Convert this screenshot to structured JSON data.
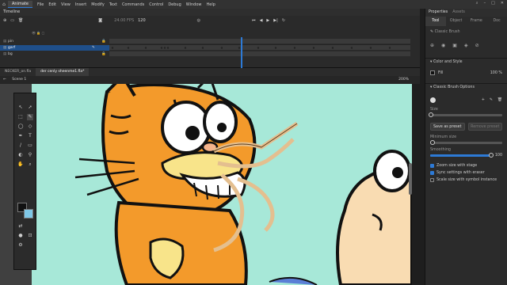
{
  "menubar": {
    "workspace": "Animate",
    "items": [
      "File",
      "Edit",
      "View",
      "Insert",
      "Modify",
      "Text",
      "Commands",
      "Control",
      "Debug",
      "Window",
      "Help"
    ]
  },
  "timeline": {
    "title": "Timeline",
    "fps": "24.00 FPS",
    "frame": "120",
    "layers": [
      {
        "name": "pin"
      },
      {
        "name": "garf"
      },
      {
        "name": "bg"
      }
    ],
    "ruler": [
      "5",
      "10",
      "15",
      "20",
      "25",
      "30",
      "35",
      "40",
      "45",
      "50",
      "55",
      "60",
      "65",
      "70",
      "75"
    ]
  },
  "docbar": {
    "tabs": [
      "NECKER_on.fla",
      "der cenly sheenme1.fla*"
    ]
  },
  "scenebar": {
    "scene": "Scene 1",
    "zoom": "200%"
  },
  "props": {
    "title": "Properties",
    "library_tab": "Assets",
    "tabs": [
      "Tool",
      "Object",
      "Frame",
      "Doc"
    ],
    "tool_name": "Classic Brush",
    "color_style": "Color and Style",
    "fill_label": "Fill",
    "fill_percent": "100 %",
    "brush_options": "Classic Brush Options",
    "size_label": "Size",
    "save_preset": "Save as preset",
    "remove_preset": "Remove preset",
    "min_size": "Minimum size",
    "smoothing": "Smoothing",
    "smoothing_value": "100",
    "checks": [
      "Zoom size with stage",
      "Sync settings with eraser",
      "Scale size with symbol instance"
    ]
  },
  "colors": {
    "accent": "#2d7ad6",
    "stage_bg": "#a7e8d8",
    "garfield": "#f39a2b"
  }
}
